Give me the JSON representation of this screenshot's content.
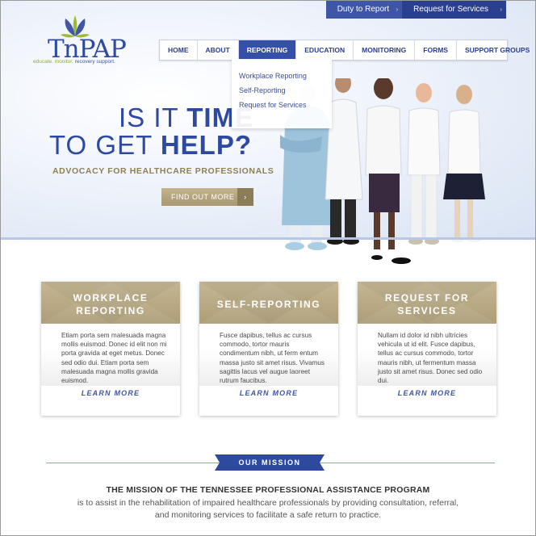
{
  "topbar": {
    "duty_label": "Duty to Report",
    "request_label": "Request for Services",
    "arrow": "›"
  },
  "logo": {
    "name": "TnPAP",
    "tag_green": "educate. monitor.",
    "tag_blue": "recovery support."
  },
  "nav": {
    "items": [
      {
        "label": "HOME"
      },
      {
        "label": "ABOUT"
      },
      {
        "label": "REPORTING"
      },
      {
        "label": "EDUCATION"
      },
      {
        "label": "MONITORING"
      },
      {
        "label": "FORMS"
      },
      {
        "label": "SUPPORT GROUPS"
      }
    ],
    "active": "REPORTING"
  },
  "dropdown": {
    "items": [
      {
        "label": "Workplace Reporting"
      },
      {
        "label": "Self-Reporting"
      },
      {
        "label": "Request for Services"
      }
    ]
  },
  "hero": {
    "line1_light": "IS IT ",
    "line1_bold": "TIME",
    "line2_light": "TO GET ",
    "line2_bold": "HELP?",
    "subtitle": "ADVOCACY FOR HEALTHCARE PROFESSIONALS",
    "cta_label": "FIND OUT MORE",
    "cta_arrow": "›"
  },
  "cards": [
    {
      "title1": "WORKPLACE",
      "title2": "REPORTING",
      "body": "Etiam porta sem malesuada magna mollis euismod. Donec id elit non mi porta gravida at eget metus. Donec sed odio dui. Etiam porta sem malesuada magna mollis gravida euismod.",
      "link": "LEARN MORE"
    },
    {
      "title1": "SELF-REPORTING",
      "title2": "",
      "body": "Fusce dapibus, tellus ac cursus commodo, tortor mauris condimentum nibh, ut ferm entum massa justo sit amet risus. Vivamus sagittis lacus vel augue laoreet rutrum faucibus.",
      "link": "LEARN MORE"
    },
    {
      "title1": "REQUEST FOR",
      "title2": "SERVICES",
      "body": "Nullam id dolor id nibh ultricies vehicula ut id elit. Fusce dapibus, tellus ac cursus commodo, tortor mauris nibh, ut fermentum massa justo sit amet risus. Donec sed odio dui.",
      "link": "LEARN MORE"
    }
  ],
  "mission": {
    "banner": "OUR MISSION",
    "title": "THE MISSION OF THE TENNESSEE PROFESSIONAL ASSISTANCE PROGRAM",
    "line1": "is to assist in the rehabilitation of impaired healthcare professionals by providing consultation, referral,",
    "line2": "and monitoring services to facilitate a safe return to practice."
  },
  "colors": {
    "brand_blue": "#2e4aa0",
    "nav_active": "#3550a8",
    "gold": "#ad9d77",
    "olive_text": "#8e7f55"
  }
}
